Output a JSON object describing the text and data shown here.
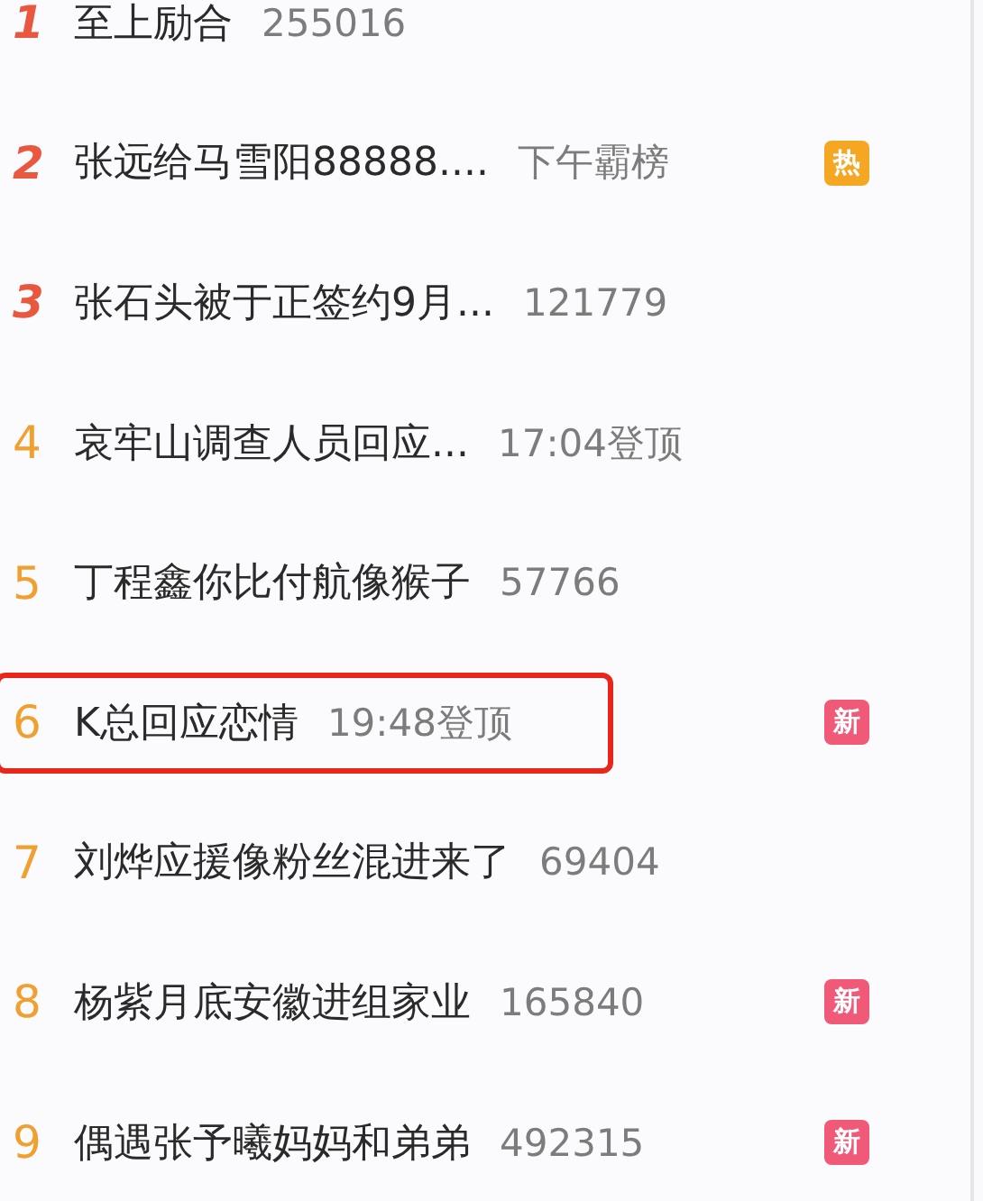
{
  "items": [
    {
      "rank": "1",
      "kind": "top",
      "title": "至上励合",
      "info": "255016",
      "highlighted": false
    },
    {
      "rank": "2",
      "kind": "top",
      "title": "张远给马雪阳88888....",
      "info": "下午霸榜",
      "highlighted": false,
      "badge": {
        "kind": "hot",
        "label": "热"
      }
    },
    {
      "rank": "3",
      "kind": "top",
      "title": "张石头被于正签约9月...",
      "info": "121779",
      "highlighted": false
    },
    {
      "rank": "4",
      "kind": "normal",
      "title": "哀牢山调查人员回应...",
      "info": "17:04登顶",
      "highlighted": false
    },
    {
      "rank": "5",
      "kind": "normal",
      "title": "丁程鑫你比付航像猴子",
      "info": "57766",
      "highlighted": false
    },
    {
      "rank": "6",
      "kind": "normal",
      "title": "K总回应恋情",
      "info": "19:48登顶",
      "highlighted": true,
      "badge": {
        "kind": "new",
        "label": "新"
      }
    },
    {
      "rank": "7",
      "kind": "normal",
      "title": "刘烨应援像粉丝混进来了",
      "info": "69404",
      "highlighted": false
    },
    {
      "rank": "8",
      "kind": "normal",
      "title": "杨紫月底安徽进组家业",
      "info": "165840",
      "highlighted": false,
      "badge": {
        "kind": "new",
        "label": "新"
      }
    },
    {
      "rank": "9",
      "kind": "normal",
      "title": "偶遇张予曦妈妈和弟弟",
      "info": "492315",
      "highlighted": false,
      "badge": {
        "kind": "new",
        "label": "新"
      }
    }
  ]
}
